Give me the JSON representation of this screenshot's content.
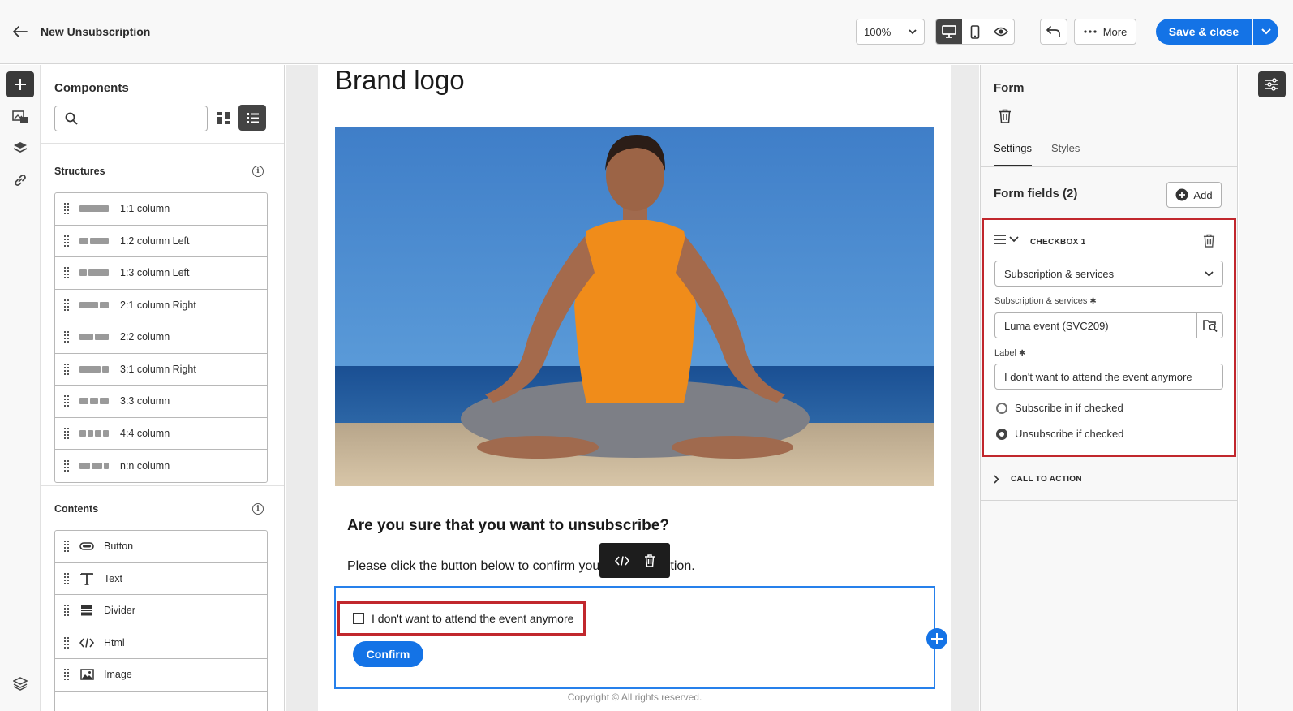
{
  "header": {
    "title": "New Unsubscription",
    "zoom": "100%",
    "more_label": "More",
    "save_label": "Save & close"
  },
  "components": {
    "title": "Components",
    "search_placeholder": "",
    "structures_title": "Structures",
    "structures": [
      {
        "label": "1:1 column",
        "cols": [
          1
        ]
      },
      {
        "label": "1:2 column Left",
        "cols": [
          1,
          2
        ]
      },
      {
        "label": "1:3 column Left",
        "cols": [
          1,
          3
        ]
      },
      {
        "label": "2:1 column Right",
        "cols": [
          2,
          1
        ]
      },
      {
        "label": "2:2 column",
        "cols": [
          1,
          1
        ]
      },
      {
        "label": "3:1 column Right",
        "cols": [
          3,
          1
        ]
      },
      {
        "label": "3:3 column",
        "cols": [
          1,
          1,
          1
        ]
      },
      {
        "label": "4:4 column",
        "cols": [
          1,
          1,
          1,
          1
        ]
      },
      {
        "label": "n:n column",
        "cols": [
          1,
          1,
          0.5
        ]
      }
    ],
    "contents_title": "Contents",
    "contents": [
      {
        "label": "Button",
        "icon": "button-icon"
      },
      {
        "label": "Text",
        "icon": "text-icon"
      },
      {
        "label": "Divider",
        "icon": "divider-icon"
      },
      {
        "label": "Html",
        "icon": "code-icon"
      },
      {
        "label": "Image",
        "icon": "image-icon"
      }
    ]
  },
  "canvas": {
    "brand_logo": "Brand logo",
    "question": "Are you sure that you want to unsubscribe?",
    "paragraph": "Please click the button below to confirm your unsubscription.",
    "checkbox_label": "I don't want to attend the event anymore",
    "confirm_label": "Confirm",
    "copyright": "Copyright ©   All rights reserved."
  },
  "properties": {
    "title": "Form",
    "tabs": [
      "Settings",
      "Styles"
    ],
    "active_tab": "Settings",
    "form_fields_title": "Form fields (2)",
    "add_label": "Add",
    "field": {
      "name": "CHECKBOX 1",
      "type_value": "Subscription & services",
      "service_label": "Subscription & services",
      "service_value": "Luma event (SVC209)",
      "label_label": "Label",
      "label_value": "I don't want to attend the event anymore",
      "radio_options": [
        "Subscribe in if checked",
        "Unsubscribe if checked"
      ],
      "radio_selected": "Unsubscribe if checked"
    },
    "call_to_action": "CALL TO ACTION"
  },
  "colors": {
    "accent": "#1473e6",
    "highlight": "#c1272d",
    "selection": "#2680eb"
  }
}
